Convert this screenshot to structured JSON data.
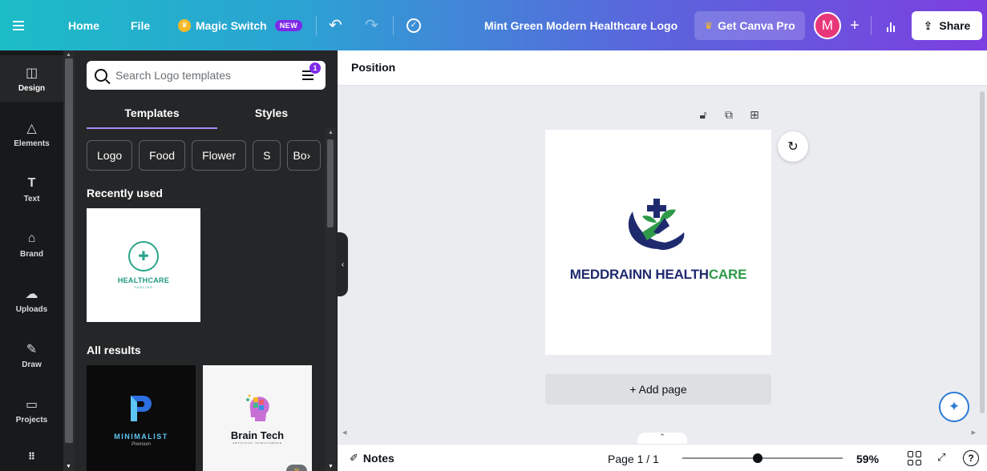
{
  "topbar": {
    "home_label": "Home",
    "file_label": "File",
    "magic_label": "Magic Switch",
    "new_badge": "NEW",
    "doc_title": "Mint Green Modern Healthcare Logo",
    "pro_label": "Get Canva Pro",
    "avatar_initial": "M",
    "share_label": "Share",
    "icons": [
      "menu-icon",
      "crown-icon",
      "undo-icon",
      "redo-icon",
      "cloud-check-icon",
      "plus-icon",
      "stats-icon",
      "share-icon"
    ]
  },
  "rail": {
    "items": [
      {
        "label": "Design",
        "icon": "layout-icon"
      },
      {
        "label": "Elements",
        "icon": "shapes-icon"
      },
      {
        "label": "Text",
        "icon": "text-icon"
      },
      {
        "label": "Brand",
        "icon": "brand-icon"
      },
      {
        "label": "Uploads",
        "icon": "upload-icon"
      },
      {
        "label": "Draw",
        "icon": "draw-icon"
      },
      {
        "label": "Projects",
        "icon": "folder-icon"
      }
    ],
    "apps_icon": "apps-grid-icon"
  },
  "panel": {
    "search_placeholder": "Search Logo templates",
    "filter_badge": "1",
    "tabs": [
      "Templates",
      "Styles"
    ],
    "chips": [
      "Logo",
      "Food",
      "Flower",
      "S",
      "Bo"
    ],
    "recently_used_title": "Recently used",
    "all_results_title": "All results",
    "recent_templates": [
      {
        "name": "HEALTHCARE",
        "tagline": "TAGLINE"
      }
    ],
    "results": [
      {
        "name": "MINIMALIST",
        "sub": "Premium"
      },
      {
        "name": "Brain Tech",
        "sub": "ARTIFICIAL INTELLIGENCE"
      }
    ]
  },
  "editor": {
    "position_label": "Position",
    "logo_text_navy": "MEDDRAINN HEALTH",
    "logo_text_green": "CARE",
    "add_page_label": "+ Add page",
    "colors": {
      "navy": "#1f2a6e",
      "green": "#2e9a49",
      "accent": "#7d2ae8"
    }
  },
  "bottombar": {
    "notes_label": "Notes",
    "page_indicator": "Page 1 / 1",
    "zoom_percent": 59,
    "zoom_label": "59%",
    "help_label": "?"
  }
}
